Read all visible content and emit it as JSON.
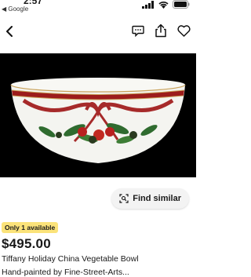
{
  "status": {
    "time": "2:57",
    "back_app": "◀ Google"
  },
  "nav": {
    "back_icon": "chevron-left-icon",
    "actions": [
      "message-icon",
      "share-icon",
      "heart-icon"
    ]
  },
  "listing": {
    "find_similar_label": "Find similar",
    "availability": "Only 1 available",
    "price": "$495.00",
    "title": "Tiffany Holiday China Vegetable Bowl",
    "subtitle": "Hand-painted by Fine-Street-Arts..."
  }
}
